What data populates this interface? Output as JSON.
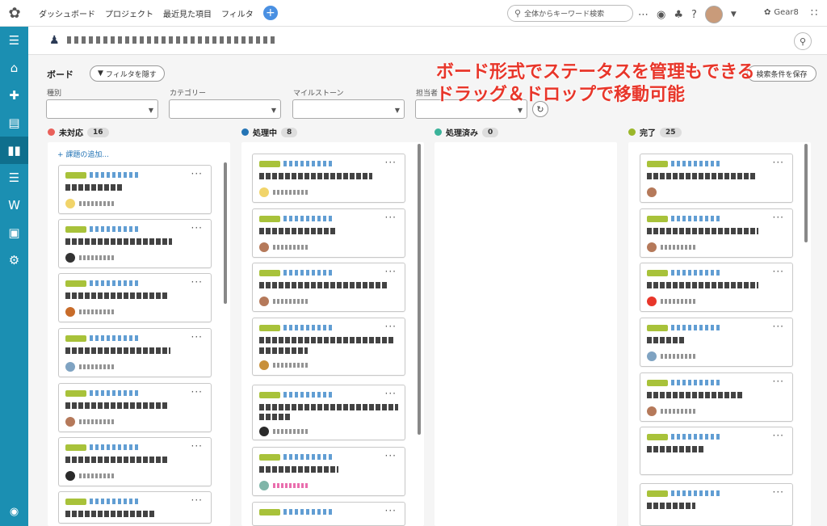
{
  "nav": {
    "links": [
      "ダッシュボード",
      "プロジェクト",
      "最近見た項目",
      "フィルタ"
    ],
    "search_placeholder": "全体からキーワード検索",
    "space_name": "Gear8"
  },
  "board": {
    "title": "ボード",
    "filter_toggle": "フィルタを隠す",
    "save_filter": "検索条件を保存",
    "filters": {
      "type_label": "種別",
      "category_label": "カテゴリー",
      "milestone_label": "マイルストーン",
      "assignee_label": "担当者"
    },
    "add_issue": "+ 課題の追加..."
  },
  "annotation": {
    "line1": "ボード形式でステータスを管理もできる",
    "line2": "ドラッグ＆ドロップで移動可能"
  },
  "columns": [
    {
      "name": "未対応",
      "count": "16",
      "color": "#e9605a"
    },
    {
      "name": "処理中",
      "count": "8",
      "color": "#2474b5"
    },
    {
      "name": "処理済み",
      "count": "0",
      "color": "#3bb39a"
    },
    {
      "name": "完了",
      "count": "25",
      "color": "#9bb72a"
    }
  ],
  "colors": {
    "sidebar": "#1b8fb2",
    "accent_red": "#e8362a",
    "tag_green": "#a8c23a"
  }
}
